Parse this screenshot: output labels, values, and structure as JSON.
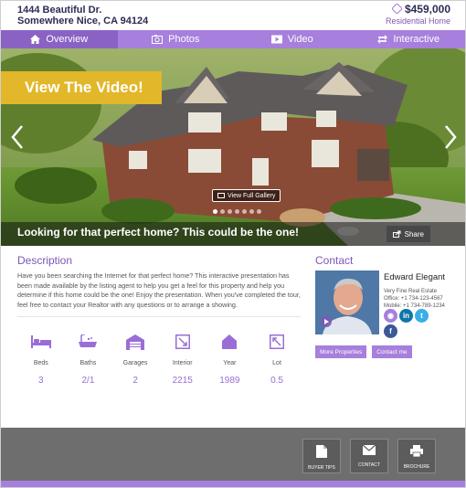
{
  "header": {
    "address_line1": "1444 Beautiful Dr.",
    "address_line2": "Somewhere Nice, CA 94124",
    "price": "$459,000",
    "property_type": "Residential Home"
  },
  "nav": {
    "tabs": [
      {
        "label": "Overview",
        "icon": "home-icon",
        "active": true
      },
      {
        "label": "Photos",
        "icon": "photos-icon",
        "active": false
      },
      {
        "label": "Video",
        "icon": "video-icon",
        "active": false
      },
      {
        "label": "Interactive",
        "icon": "interactive-icon",
        "active": false
      }
    ]
  },
  "hero": {
    "video_banner": "View The Video!",
    "gallery_button": "View Full Gallery",
    "caption": "Looking for that perfect home? This could be the one!",
    "share_label": "Share",
    "dots_count": 7,
    "active_dot": 0
  },
  "description": {
    "heading": "Description",
    "text": "Have you been searching the Internet for that perfect home? This interactive presentation has been made available by the listing agent to help you get a feel for this property and help you determine if this home could be the one! Enjoy the presentation. When you've completed the tour, feel free to contact your Realtor with any questions or to arrange a showing."
  },
  "stats": [
    {
      "label": "Beds",
      "value": "3",
      "icon": "bed-icon"
    },
    {
      "label": "Baths",
      "value": "2/1",
      "icon": "bath-icon"
    },
    {
      "label": "Garages",
      "value": "2",
      "icon": "garage-icon"
    },
    {
      "label": "Interior",
      "value": "2215",
      "icon": "interior-icon"
    },
    {
      "label": "Year",
      "value": "1989",
      "icon": "year-icon"
    },
    {
      "label": "Lot",
      "value": "0.5",
      "icon": "lot-icon"
    }
  ],
  "contact": {
    "heading": "Contact",
    "agent_name": "Edward Elegant",
    "company": "Very Fine Real Estate",
    "office": "Office: +1 734-123-4567",
    "mobile": "Mobile: +1 734-789-1234",
    "more_properties": "More Properties",
    "contact_me": "Contact me"
  },
  "footer": {
    "tiles": [
      {
        "label": "BUYER TIPS",
        "icon": "document-icon"
      },
      {
        "label": "CONTACT",
        "icon": "envelope-icon"
      },
      {
        "label": "BROCHURE",
        "icon": "printer-icon"
      }
    ]
  },
  "colors": {
    "accent": "#a77fdc",
    "accent_dark": "#8a62c4",
    "banner_yellow": "#e2b72a",
    "footer_gray": "#6e6e6e"
  }
}
